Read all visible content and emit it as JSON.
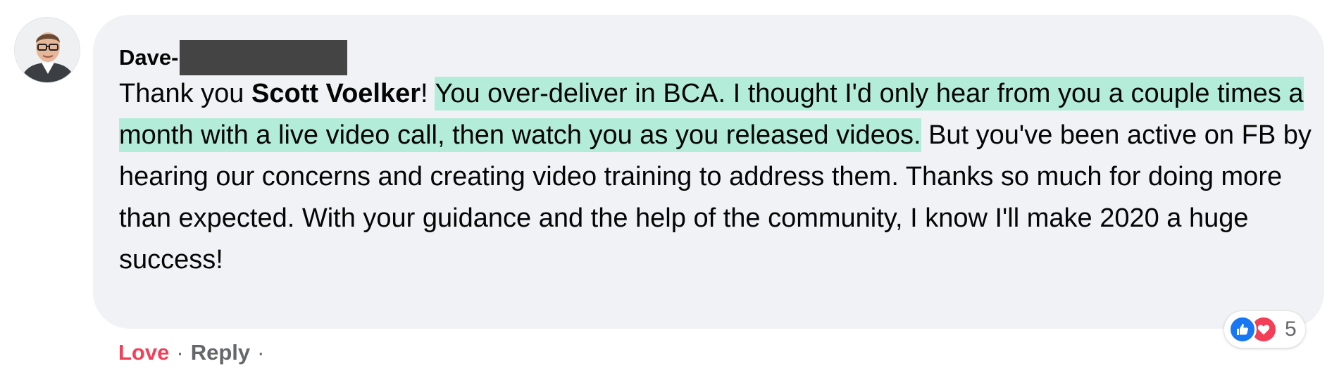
{
  "comment": {
    "author": "Dave-",
    "text_intro": "Thank you ",
    "mention": "Scott Voelker",
    "text_after_mention": "! ",
    "highlighted_text": "You over-deliver in BCA. I thought I'd only hear from you a couple times a month with a live video call, then watch you as you released videos.",
    "text_rest": " But you've been active on FB by hearing our concerns and creating video training to address them. Thanks so much for doing more than expected. With your guidance and the help of the community, I know I'll make 2020 a huge success!"
  },
  "reactions": {
    "icons": [
      "like-icon",
      "love-icon"
    ],
    "count": "5"
  },
  "actions": {
    "love_label": "Love",
    "separator": "·",
    "reply_label": "Reply"
  },
  "colors": {
    "bubble": "#f0f2f5",
    "highlight": "#b3ecd9",
    "love": "#f33e58",
    "like": "#1877f2",
    "secondary_text": "#65676b"
  }
}
